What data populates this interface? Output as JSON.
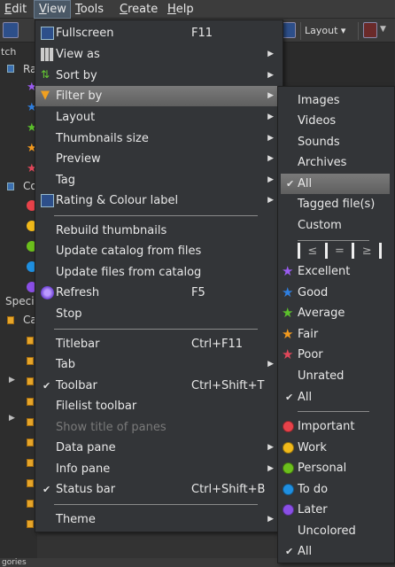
{
  "menubar": {
    "items": [
      {
        "pre": "",
        "u": "E",
        "post": "dit"
      },
      {
        "pre": "",
        "u": "V",
        "post": "iew"
      },
      {
        "pre": "",
        "u": "T",
        "post": "ools"
      },
      {
        "pre": "",
        "u": "C",
        "post": "reate"
      },
      {
        "pre": "",
        "u": "H",
        "post": "elp"
      }
    ]
  },
  "toolbar": {
    "layout_label": "Layout"
  },
  "background": {
    "left_labels": [
      "tch",
      "Ra",
      "Co",
      "Speci",
      "Ca"
    ],
    "status_text": "gories"
  },
  "view_menu": {
    "items": [
      {
        "label": "Fullscreen",
        "shortcut": "F11",
        "icon": "fullscreen-icon"
      },
      {
        "label": "View as",
        "submenu": true,
        "icon": "view-as-icon"
      },
      {
        "label": "Sort by",
        "submenu": true,
        "icon": "sort-icon"
      },
      {
        "label": "Filter by",
        "submenu": true,
        "icon": "filter-icon",
        "highlighted": true
      },
      {
        "label": "Layout",
        "submenu": true
      },
      {
        "label": "Thumbnails size",
        "submenu": true
      },
      {
        "label": "Preview",
        "submenu": true
      },
      {
        "label": "Tag",
        "submenu": true
      },
      {
        "label": "Rating & Colour label",
        "submenu": true,
        "icon": "rating-icon"
      },
      {
        "label": "Rebuild thumbnails"
      },
      {
        "label": "Update catalog from files"
      },
      {
        "label": "Update files from catalog"
      },
      {
        "label": "Refresh",
        "shortcut": "F5",
        "icon": "refresh-icon"
      },
      {
        "label": "Stop"
      },
      {
        "label": "Titlebar",
        "shortcut": "Ctrl+F11"
      },
      {
        "label": "Tab",
        "submenu": true
      },
      {
        "label": "Toolbar",
        "shortcut": "Ctrl+Shift+T",
        "checked": true
      },
      {
        "label": "Filelist toolbar"
      },
      {
        "label": "Show title of panes",
        "disabled": true
      },
      {
        "label": "Data pane",
        "submenu": true
      },
      {
        "label": "Info pane",
        "submenu": true
      },
      {
        "label": "Status bar",
        "shortcut": "Ctrl+Shift+B",
        "checked": true
      },
      {
        "label": "Theme",
        "submenu": true
      }
    ]
  },
  "filter_menu": {
    "type_items": [
      {
        "label": "Images"
      },
      {
        "label": "Videos"
      },
      {
        "label": "Sounds"
      },
      {
        "label": "Archives"
      },
      {
        "label": "All",
        "checked": true,
        "highlighted": true
      },
      {
        "label": "Tagged file(s)"
      },
      {
        "label": "Custom"
      }
    ],
    "operators": [
      "≤",
      "=",
      "≥"
    ],
    "rating_items": [
      {
        "label": "Excellent",
        "color": "#9a5cf0"
      },
      {
        "label": "Good",
        "color": "#2f7fe0"
      },
      {
        "label": "Average",
        "color": "#5cc12c"
      },
      {
        "label": "Fair",
        "color": "#f39a1e"
      },
      {
        "label": "Poor",
        "color": "#e0475a"
      },
      {
        "label": "Unrated"
      },
      {
        "label": "All",
        "checked": true
      }
    ],
    "color_items": [
      {
        "label": "Important",
        "color": "#e8424a"
      },
      {
        "label": "Work",
        "color": "#f0b91a"
      },
      {
        "label": "Personal",
        "color": "#6cbf1c"
      },
      {
        "label": "To do",
        "color": "#1f8fe0"
      },
      {
        "label": "Later",
        "color": "#8a4fe6"
      },
      {
        "label": "Uncolored"
      },
      {
        "label": "All",
        "checked": true
      }
    ]
  }
}
